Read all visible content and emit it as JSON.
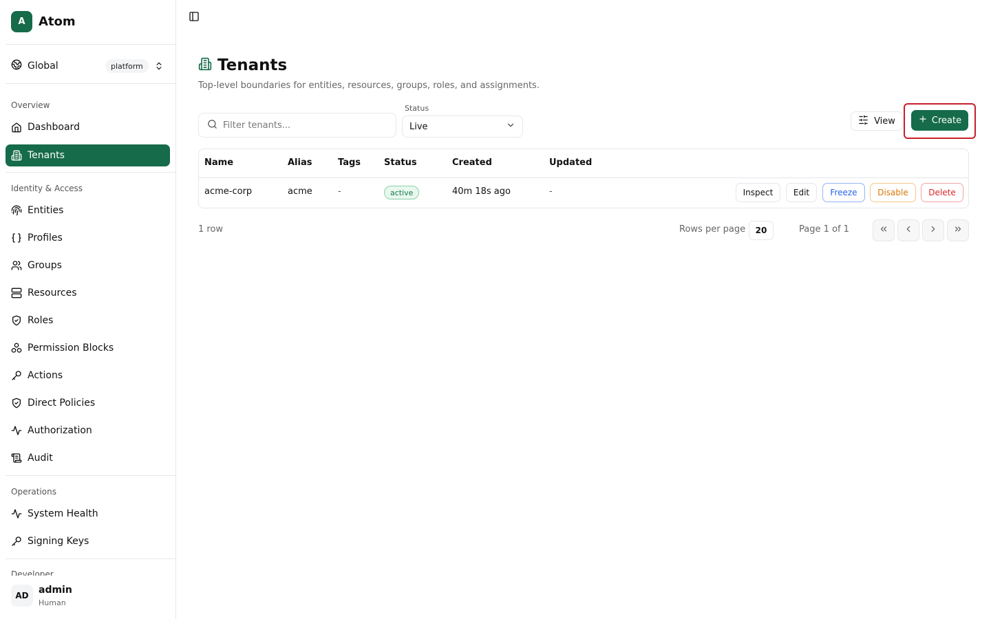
{
  "app": {
    "logo_letter": "A",
    "name": "Atom"
  },
  "scope": {
    "label": "Global",
    "badge": "platform"
  },
  "sidebar": {
    "sections": [
      {
        "title": "Overview"
      },
      {
        "title": "Identity & Access"
      },
      {
        "title": "Operations"
      },
      {
        "title": "Developer"
      }
    ],
    "items": [
      {
        "label": "Dashboard",
        "icon": "home-icon"
      },
      {
        "label": "Tenants",
        "icon": "building-icon",
        "active": true
      },
      {
        "label": "Entities",
        "icon": "fingerprint-icon"
      },
      {
        "label": "Profiles",
        "icon": "braces-icon"
      },
      {
        "label": "Groups",
        "icon": "users-icon"
      },
      {
        "label": "Resources",
        "icon": "server-icon"
      },
      {
        "label": "Roles",
        "icon": "shield-check-icon"
      },
      {
        "label": "Permission Blocks",
        "icon": "blocks-icon"
      },
      {
        "label": "Actions",
        "icon": "key-icon"
      },
      {
        "label": "Direct Policies",
        "icon": "shield-check-icon"
      },
      {
        "label": "Authorization",
        "icon": "activity-icon"
      },
      {
        "label": "Audit",
        "icon": "scroll-icon"
      },
      {
        "label": "System Health",
        "icon": "activity-icon"
      },
      {
        "label": "Signing Keys",
        "icon": "key-icon"
      }
    ]
  },
  "user": {
    "initials": "AD",
    "name": "admin",
    "role": "Human"
  },
  "page": {
    "title": "Tenants",
    "subtitle": "Top-level boundaries for entities, resources, groups, roles, and assignments."
  },
  "filters": {
    "search_placeholder": "Filter tenants...",
    "status_label": "Status",
    "status_value": "Live"
  },
  "toolbar": {
    "view_label": "View",
    "create_label": "Create"
  },
  "table": {
    "columns": [
      "Name",
      "Alias",
      "Tags",
      "Status",
      "Created",
      "Updated"
    ],
    "rows": [
      {
        "name": "acme-corp",
        "alias": "acme",
        "tags": "-",
        "status": "active",
        "created": "40m 18s ago",
        "updated": "-",
        "actions": [
          "Inspect",
          "Edit",
          "Freeze",
          "Disable",
          "Delete"
        ]
      }
    ]
  },
  "pagination": {
    "row_count": "1 row",
    "rows_per_page_label": "Rows per page",
    "rows_per_page_value": "20",
    "page_info": "Page 1 of 1"
  },
  "colors": {
    "brand": "#166b4a",
    "freeze": "#2563eb",
    "disable": "#d97706",
    "delete": "#dc2626",
    "highlight": "#c81e2a"
  }
}
